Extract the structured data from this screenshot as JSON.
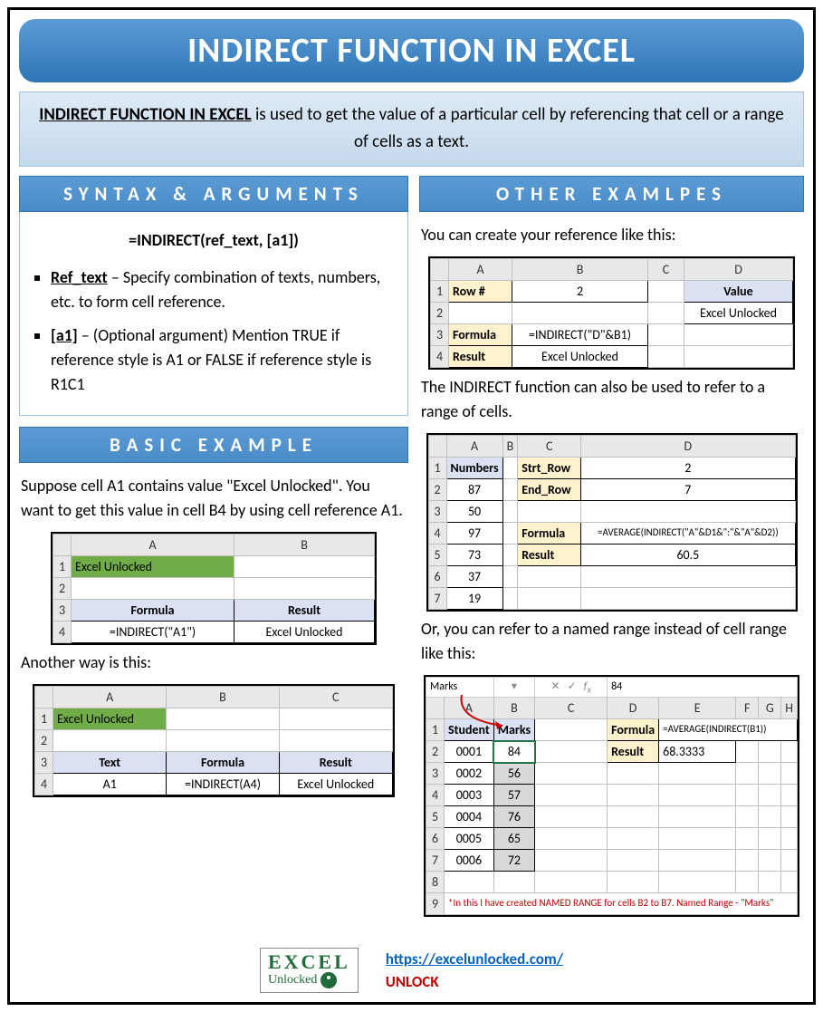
{
  "title": "INDIRECT FUNCTION IN EXCEL",
  "intro": {
    "bold": "INDIRECT FUNCTION IN EXCEL",
    "rest": " is used to get the value of a particular cell by referencing that cell or a range of cells as a text."
  },
  "syntax": {
    "header": "SYNTAX & ARGUMENTS",
    "formula": "=INDIRECT(ref_text, [a1])",
    "args": [
      {
        "name": "Ref_text",
        "desc": " – Specify combination of texts, numbers, etc. to form cell reference."
      },
      {
        "name": "[a1]",
        "desc": " – (Optional argument) Mention TRUE if reference style is A1 or FALSE if reference style is R1C1"
      }
    ]
  },
  "basic": {
    "header": "BASIC EXAMPLE",
    "p1": "Suppose cell A1 contains value \"Excel Unlocked\". You want to get this value in cell B4 by using cell reference A1.",
    "table1": {
      "cols": [
        "A",
        "B"
      ],
      "rows": [
        [
          "Excel Unlocked",
          ""
        ],
        [
          "",
          ""
        ],
        [
          "Formula",
          "Result"
        ],
        [
          "=INDIRECT(\"A1\")",
          "Excel Unlocked"
        ]
      ]
    },
    "p2": "Another way is this:",
    "table2": {
      "cols": [
        "A",
        "B",
        "C"
      ],
      "rows": [
        [
          "Excel Unlocked",
          "",
          ""
        ],
        [
          "",
          "",
          ""
        ],
        [
          "Text",
          "Formula",
          "Result"
        ],
        [
          "A1",
          "=INDIRECT(A4)",
          "Excel Unlocked"
        ]
      ]
    }
  },
  "other": {
    "header": "OTHER EXAMLPES",
    "p1": "You can create your reference like this:",
    "table1": {
      "cols": [
        "A",
        "B",
        "C",
        "D"
      ],
      "r1": [
        "Row #",
        "2",
        "",
        "Value"
      ],
      "r2": [
        "",
        "",
        "",
        "Excel Unlocked"
      ],
      "r3": [
        "Formula",
        "=INDIRECT(\"D\"&B1)",
        "",
        ""
      ],
      "r4": [
        "Result",
        "Excel Unlocked",
        "",
        ""
      ]
    },
    "p2": "The INDIRECT function can also be used to refer to a range of cells.",
    "table2": {
      "cols": [
        "A",
        "B",
        "C",
        "D"
      ],
      "numbers_label": "Numbers",
      "numbers": [
        "87",
        "50",
        "97",
        "73",
        "37",
        "19"
      ],
      "strt_label": "Strt_Row",
      "strt_val": "2",
      "end_label": "End_Row",
      "end_val": "7",
      "formula_label": "Formula",
      "formula_val": "=AVERAGE(INDIRECT(\"A\"&D1&\":\"&\"A\"&D2))",
      "result_label": "Result",
      "result_val": "60.5"
    },
    "p3": "Or, you can refer to a named range instead of cell range like this:",
    "table3": {
      "namebox": "Marks",
      "fx": "84",
      "cols": [
        "A",
        "B",
        "C",
        "D",
        "E",
        "F",
        "G",
        "H"
      ],
      "hdr": [
        "Student",
        "Marks"
      ],
      "data": [
        [
          "0001",
          "84"
        ],
        [
          "0002",
          "56"
        ],
        [
          "0003",
          "57"
        ],
        [
          "0004",
          "76"
        ],
        [
          "0005",
          "65"
        ],
        [
          "0006",
          "72"
        ]
      ],
      "formula_label": "Formula",
      "formula_val": "=AVERAGE(INDIRECT(B1))",
      "result_label": "Result",
      "result_val": "68.3333",
      "footnote": "*In this I have created NAMED RANGE for cells B2 to B7. Named Range - \"Marks\""
    }
  },
  "footer": {
    "logo1": "EXCEL",
    "logo2": "Unlocked",
    "url": "https://excelunlocked.com/",
    "unlock": "UNLOCK"
  }
}
